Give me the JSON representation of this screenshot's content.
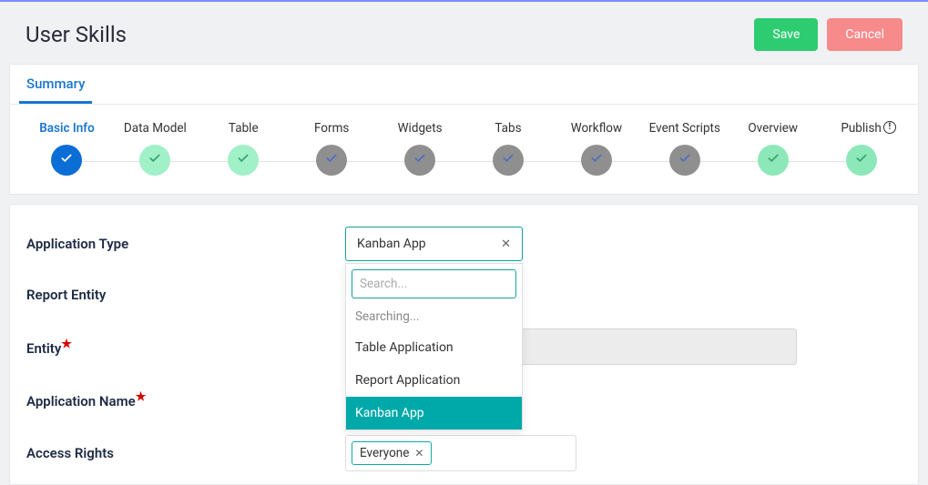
{
  "header": {
    "title": "User Skills",
    "save": "Save",
    "cancel": "Cancel"
  },
  "tabs": {
    "summary": "Summary"
  },
  "steps": [
    {
      "label": "Basic Info",
      "state": "blue",
      "active": true
    },
    {
      "label": "Data Model",
      "state": "green"
    },
    {
      "label": "Table",
      "state": "green"
    },
    {
      "label": "Forms",
      "state": "gray"
    },
    {
      "label": "Widgets",
      "state": "gray"
    },
    {
      "label": "Tabs",
      "state": "gray"
    },
    {
      "label": "Workflow",
      "state": "gray"
    },
    {
      "label": "Event Scripts",
      "state": "gray"
    },
    {
      "label": "Overview",
      "state": "green2"
    },
    {
      "label": "Publish",
      "state": "green2",
      "badge": "!"
    }
  ],
  "form": {
    "application_type": {
      "label": "Application Type",
      "value": "Kanban App"
    },
    "report_entity": {
      "label": "Report Entity"
    },
    "entity": {
      "label": "Entity",
      "required": true
    },
    "application_name": {
      "label": "Application Name",
      "required": true
    },
    "access_rights": {
      "label": "Access Rights",
      "value": "Everyone"
    }
  },
  "dropdown": {
    "search_placeholder": "Search...",
    "status": "Searching...",
    "options": [
      "Table Application",
      "Report Application",
      "Kanban App"
    ],
    "selected": "Kanban App"
  }
}
